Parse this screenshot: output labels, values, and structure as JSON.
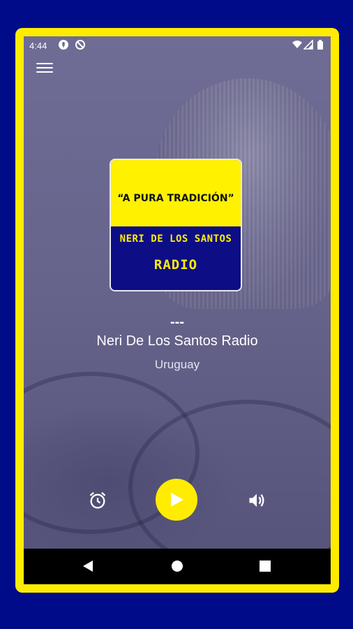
{
  "status_bar": {
    "time": "4:44",
    "icons": [
      "mic-icon",
      "do-not-disturb-icon",
      "wifi-icon",
      "signal-icon",
      "battery-icon"
    ]
  },
  "menu": {
    "icon": "hamburger-menu-icon"
  },
  "logo": {
    "tagline": "“A PURA TRADICIÓN”",
    "name": "NERI DE LOS SANTOS",
    "word": "RADIO",
    "colors": {
      "top": "#fff100",
      "bottom": "#0d0e86",
      "text": "#ffec00"
    }
  },
  "now_playing": {
    "track": "---",
    "station": "Neri De Los Santos Radio",
    "country": "Uruguay"
  },
  "controls": {
    "alarm_icon": "alarm-clock-icon",
    "play_icon": "play-icon",
    "volume_icon": "volume-icon",
    "accent": "#ffec00"
  },
  "nav_bar": {
    "buttons": [
      "back-icon",
      "home-icon",
      "recents-icon"
    ]
  },
  "colors": {
    "outer_background": "#000b8a",
    "frame": "#ffec00"
  }
}
